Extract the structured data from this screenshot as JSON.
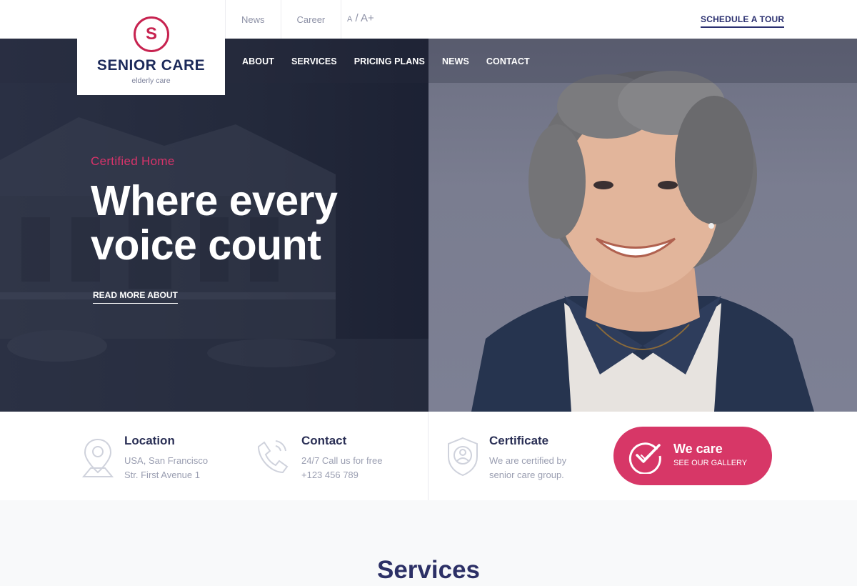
{
  "topbar": {
    "links": [
      "News",
      "Career"
    ],
    "font_small": "A",
    "font_sep": "/",
    "font_big": "A+",
    "schedule": "SCHEDULE A TOUR"
  },
  "logo": {
    "letter": "S",
    "name": "SENIOR CARE",
    "tagline": "elderly care"
  },
  "nav": [
    "ABOUT",
    "SERVICES",
    "PRICING PLANS",
    "NEWS",
    "CONTACT"
  ],
  "hero": {
    "eyebrow": "Certified Home",
    "headline_line1": "Where every",
    "headline_line2": "voice count",
    "cta": "READ MORE ABOUT"
  },
  "info": {
    "location": {
      "title": "Location",
      "line1": "USA, San Francisco",
      "line2": "Str. First Avenue 1",
      "icon": "map-pin-icon"
    },
    "contact": {
      "title": "Contact",
      "line1": "24/7 Call us for free",
      "line2": "+123 456 789",
      "icon": "phone-icon"
    },
    "certificate": {
      "title": "Certificate",
      "line1": "We are certified by",
      "line2": "senior care group.",
      "icon": "shield-user-icon"
    }
  },
  "wecare": {
    "title": "We care",
    "sub": "SEE OUR GALLERY",
    "icon": "check-circle-icon"
  },
  "services": {
    "heading": "Services"
  },
  "colors": {
    "accent": "#d73767",
    "brand_navy": "#1c2a5a",
    "hero_dark": "#242a3c"
  }
}
